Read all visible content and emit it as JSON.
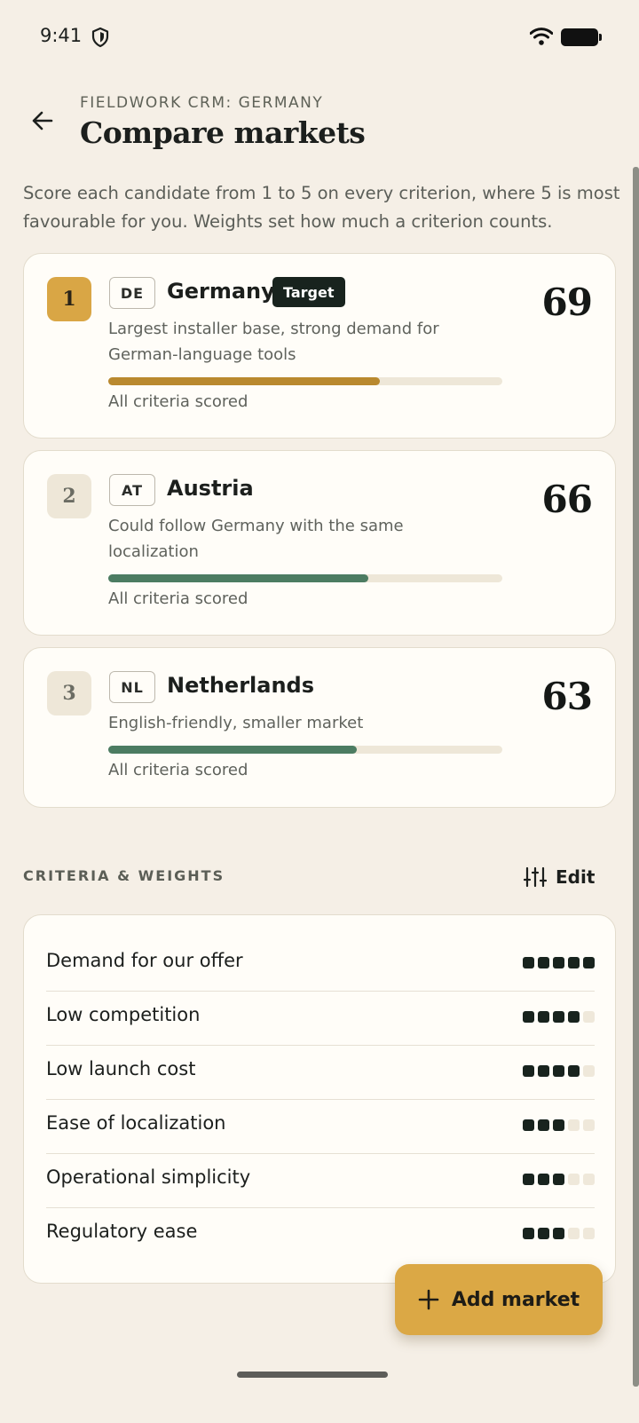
{
  "status_bar": {
    "time": "9:41"
  },
  "header": {
    "eyebrow": "FIELDWORK CRM: GERMANY",
    "title": "Compare markets",
    "intro": "Score each candidate from 1 to 5 on every criterion, where 5 is most favourable for you. Weights set how much a criterion counts."
  },
  "markets": [
    {
      "rank": "1",
      "code": "DE",
      "name": "Germany",
      "badge": "Target",
      "description": "Largest installer base, strong demand for German-language tools",
      "score": "69",
      "score_value": 69,
      "status": "All criteria scored"
    },
    {
      "rank": "2",
      "code": "AT",
      "name": "Austria",
      "description": "Could follow Germany with the same localization",
      "score": "66",
      "score_value": 66,
      "status": "All criteria scored"
    },
    {
      "rank": "3",
      "code": "NL",
      "name": "Netherlands",
      "description": "English-friendly, smaller market",
      "score": "63",
      "score_value": 63,
      "status": "All criteria scored"
    }
  ],
  "criteria_section": {
    "label": "CRITERIA & WEIGHTS",
    "edit_label": "Edit",
    "items": [
      {
        "name": "Demand for our offer",
        "weight": 5,
        "max": 5
      },
      {
        "name": "Low competition",
        "weight": 4,
        "max": 5
      },
      {
        "name": "Low launch cost",
        "weight": 4,
        "max": 5
      },
      {
        "name": "Ease of localization",
        "weight": 3,
        "max": 5
      },
      {
        "name": "Operational simplicity",
        "weight": 3,
        "max": 5
      },
      {
        "name": "Regulatory ease",
        "weight": 3,
        "max": 5
      }
    ]
  },
  "fab": {
    "label": "Add market"
  },
  "colors": {
    "background": "#f5efe6",
    "accent_gold": "#dba845",
    "bar_gold": "#b9892f",
    "bar_green": "#4c7c62",
    "dark": "#18231e"
  },
  "icons": {
    "back": "arrow-left-icon",
    "shield": "shield-icon",
    "wifi": "wifi-icon",
    "battery": "battery-icon",
    "edit": "sliders-icon",
    "add": "plus-icon"
  }
}
